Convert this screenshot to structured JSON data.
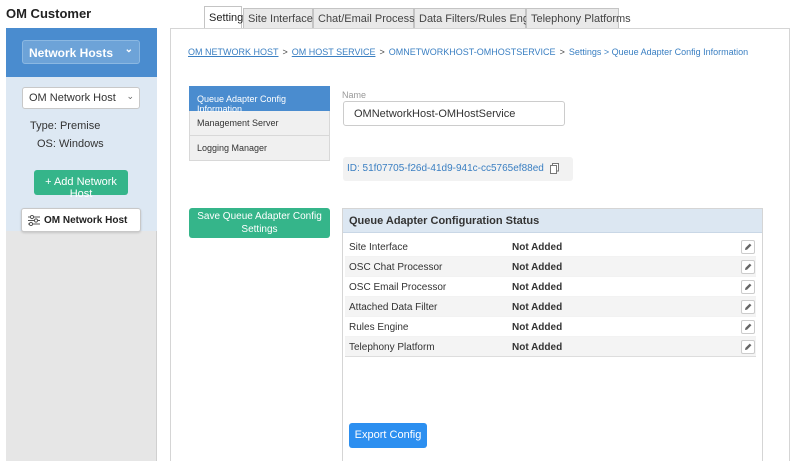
{
  "app": {
    "title": "OM Customer"
  },
  "sidebar": {
    "network_hosts_select": "Network Hosts",
    "host_select": "OM Network Host",
    "type_label": "Type:",
    "type_value": "Premise",
    "os_label": "OS:",
    "os_value": "Windows",
    "add_button": "+ Add Network Host",
    "host_card": "OM Network Host"
  },
  "tabs": [
    {
      "label": "Settings",
      "active": true
    },
    {
      "label": "Site Interfaces",
      "active": false
    },
    {
      "label": "Chat/Email Processors",
      "active": false
    },
    {
      "label": "Data Filters/Rules Engine",
      "active": false
    },
    {
      "label": "Telephony Platforms",
      "active": false
    }
  ],
  "breadcrumb": {
    "items": [
      "OM NETWORK HOST",
      "OM HOST SERVICE",
      "OMNETWORKHOST-OMHOSTSERVICE"
    ],
    "separator": ">",
    "tail": "Settings > Queue Adapter Config Information"
  },
  "settings_menu": [
    {
      "label": "Queue Adapter Config Information",
      "active": true
    },
    {
      "label": "Management Server",
      "active": false
    },
    {
      "label": "Logging Manager",
      "active": false
    }
  ],
  "form": {
    "name_label": "Name",
    "name_value": "OMNetworkHost-OMHostService",
    "id_text": "ID: 51f07705-f26d-41d9-941c-cc5765ef88ed"
  },
  "save_button": "Save Queue Adapter Config Settings",
  "status": {
    "title": "Queue Adapter Configuration Status",
    "rows": [
      {
        "label": "Site Interface",
        "value": "Not Added"
      },
      {
        "label": "OSC Chat Processor",
        "value": "Not Added"
      },
      {
        "label": "OSC Email Processor",
        "value": "Not Added"
      },
      {
        "label": "Attached Data Filter",
        "value": "Not Added"
      },
      {
        "label": "Rules Engine",
        "value": "Not Added"
      },
      {
        "label": "Telephony Platform",
        "value": "Not Added"
      }
    ],
    "export_button": "Export Config"
  },
  "colors": {
    "primary_blue": "#4a8ccf",
    "green_button": "#35b58a",
    "export_blue": "#2c8ff0",
    "status_header": "#dce7f2"
  },
  "icons": {
    "chevron": "chevron-down-icon",
    "copy": "copy-icon",
    "edit": "pencil-icon",
    "sliders": "sliders-icon"
  }
}
